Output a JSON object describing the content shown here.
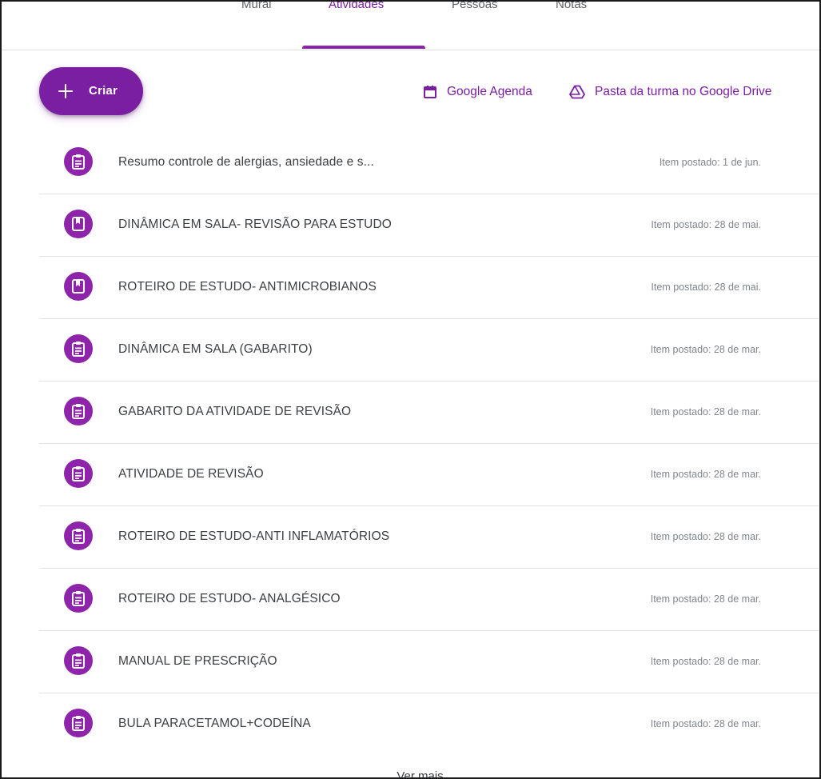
{
  "tabs": [
    {
      "label": "Mural",
      "active": false
    },
    {
      "label": "Atividades",
      "active": true
    },
    {
      "label": "Pessoas",
      "active": false
    },
    {
      "label": "Notas",
      "active": false
    }
  ],
  "create_button": {
    "label": "Criar",
    "icon": "plus-icon"
  },
  "links": {
    "calendar": {
      "label": "Google Agenda",
      "icon": "calendar-icon"
    },
    "drive": {
      "label": "Pasta da turma no Google Drive",
      "icon": "drive-icon"
    }
  },
  "items": [
    {
      "title": "Resumo controle de alergias, ansiedade e s...",
      "date": "Item postado: 1 de jun.",
      "icon": "assignment-icon"
    },
    {
      "title": "DINÂMICA EM SALA- REVISÃO PARA ESTUDO",
      "date": "Item postado: 28 de mai.",
      "icon": "material-icon"
    },
    {
      "title": "ROTEIRO DE ESTUDO- ANTIMICROBIANOS",
      "date": "Item postado: 28 de mai.",
      "icon": "material-icon"
    },
    {
      "title": "DINÂMICA EM SALA (GABARITO)",
      "date": "Item postado: 28 de mar.",
      "icon": "assignment-icon"
    },
    {
      "title": "GABARITO DA ATIVIDADE DE REVISÃO",
      "date": "Item postado: 28 de mar.",
      "icon": "assignment-icon"
    },
    {
      "title": "ATIVIDADE DE REVISÃO",
      "date": "Item postado: 28 de mar.",
      "icon": "assignment-icon"
    },
    {
      "title": "ROTEIRO DE ESTUDO-ANTI INFLAMATÓRIOS",
      "date": "Item postado: 28 de mar.",
      "icon": "assignment-icon"
    },
    {
      "title": "ROTEIRO DE ESTUDO- ANALGÉSICO",
      "date": "Item postado: 28 de mar.",
      "icon": "assignment-icon"
    },
    {
      "title": "MANUAL DE PRESCRIÇÃO",
      "date": "Item postado: 28 de mar.",
      "icon": "assignment-icon"
    },
    {
      "title": "BULA PARACETAMOL+CODEÍNA",
      "date": "Item postado: 28 de mar.",
      "icon": "assignment-icon"
    }
  ],
  "see_more": "Ver mais",
  "colors": {
    "accent": "#7b1fa2",
    "icon_bg": "#8e24aa",
    "divider": "#e0e0e0",
    "date_text": "#80868b"
  }
}
